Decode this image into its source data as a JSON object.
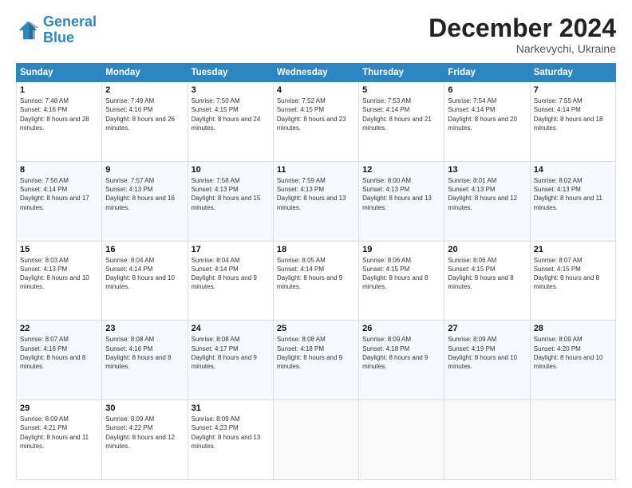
{
  "logo": {
    "line1": "General",
    "line2": "Blue"
  },
  "header": {
    "month": "December 2024",
    "location": "Narkevychi, Ukraine"
  },
  "days_of_week": [
    "Sunday",
    "Monday",
    "Tuesday",
    "Wednesday",
    "Thursday",
    "Friday",
    "Saturday"
  ],
  "weeks": [
    [
      {
        "day": 1,
        "sunrise": "Sunrise: 7:48 AM",
        "sunset": "Sunset: 4:16 PM",
        "daylight": "Daylight: 8 hours and 28 minutes."
      },
      {
        "day": 2,
        "sunrise": "Sunrise: 7:49 AM",
        "sunset": "Sunset: 4:16 PM",
        "daylight": "Daylight: 8 hours and 26 minutes."
      },
      {
        "day": 3,
        "sunrise": "Sunrise: 7:50 AM",
        "sunset": "Sunset: 4:15 PM",
        "daylight": "Daylight: 8 hours and 24 minutes."
      },
      {
        "day": 4,
        "sunrise": "Sunrise: 7:52 AM",
        "sunset": "Sunset: 4:15 PM",
        "daylight": "Daylight: 8 hours and 23 minutes."
      },
      {
        "day": 5,
        "sunrise": "Sunrise: 7:53 AM",
        "sunset": "Sunset: 4:14 PM",
        "daylight": "Daylight: 8 hours and 21 minutes."
      },
      {
        "day": 6,
        "sunrise": "Sunrise: 7:54 AM",
        "sunset": "Sunset: 4:14 PM",
        "daylight": "Daylight: 8 hours and 20 minutes."
      },
      {
        "day": 7,
        "sunrise": "Sunrise: 7:55 AM",
        "sunset": "Sunset: 4:14 PM",
        "daylight": "Daylight: 8 hours and 18 minutes."
      }
    ],
    [
      {
        "day": 8,
        "sunrise": "Sunrise: 7:56 AM",
        "sunset": "Sunset: 4:14 PM",
        "daylight": "Daylight: 8 hours and 17 minutes."
      },
      {
        "day": 9,
        "sunrise": "Sunrise: 7:57 AM",
        "sunset": "Sunset: 4:13 PM",
        "daylight": "Daylight: 8 hours and 16 minutes."
      },
      {
        "day": 10,
        "sunrise": "Sunrise: 7:58 AM",
        "sunset": "Sunset: 4:13 PM",
        "daylight": "Daylight: 8 hours and 15 minutes."
      },
      {
        "day": 11,
        "sunrise": "Sunrise: 7:59 AM",
        "sunset": "Sunset: 4:13 PM",
        "daylight": "Daylight: 8 hours and 13 minutes."
      },
      {
        "day": 12,
        "sunrise": "Sunrise: 8:00 AM",
        "sunset": "Sunset: 4:13 PM",
        "daylight": "Daylight: 8 hours and 13 minutes."
      },
      {
        "day": 13,
        "sunrise": "Sunrise: 8:01 AM",
        "sunset": "Sunset: 4:13 PM",
        "daylight": "Daylight: 8 hours and 12 minutes."
      },
      {
        "day": 14,
        "sunrise": "Sunrise: 8:02 AM",
        "sunset": "Sunset: 4:13 PM",
        "daylight": "Daylight: 8 hours and 11 minutes."
      }
    ],
    [
      {
        "day": 15,
        "sunrise": "Sunrise: 8:03 AM",
        "sunset": "Sunset: 4:13 PM",
        "daylight": "Daylight: 8 hours and 10 minutes."
      },
      {
        "day": 16,
        "sunrise": "Sunrise: 8:04 AM",
        "sunset": "Sunset: 4:14 PM",
        "daylight": "Daylight: 8 hours and 10 minutes."
      },
      {
        "day": 17,
        "sunrise": "Sunrise: 8:04 AM",
        "sunset": "Sunset: 4:14 PM",
        "daylight": "Daylight: 8 hours and 9 minutes."
      },
      {
        "day": 18,
        "sunrise": "Sunrise: 8:05 AM",
        "sunset": "Sunset: 4:14 PM",
        "daylight": "Daylight: 8 hours and 9 minutes."
      },
      {
        "day": 19,
        "sunrise": "Sunrise: 8:06 AM",
        "sunset": "Sunset: 4:15 PM",
        "daylight": "Daylight: 8 hours and 8 minutes."
      },
      {
        "day": 20,
        "sunrise": "Sunrise: 8:06 AM",
        "sunset": "Sunset: 4:15 PM",
        "daylight": "Daylight: 8 hours and 8 minutes."
      },
      {
        "day": 21,
        "sunrise": "Sunrise: 8:07 AM",
        "sunset": "Sunset: 4:15 PM",
        "daylight": "Daylight: 8 hours and 8 minutes."
      }
    ],
    [
      {
        "day": 22,
        "sunrise": "Sunrise: 8:07 AM",
        "sunset": "Sunset: 4:16 PM",
        "daylight": "Daylight: 8 hours and 8 minutes."
      },
      {
        "day": 23,
        "sunrise": "Sunrise: 8:08 AM",
        "sunset": "Sunset: 4:16 PM",
        "daylight": "Daylight: 8 hours and 8 minutes."
      },
      {
        "day": 24,
        "sunrise": "Sunrise: 8:08 AM",
        "sunset": "Sunset: 4:17 PM",
        "daylight": "Daylight: 8 hours and 9 minutes."
      },
      {
        "day": 25,
        "sunrise": "Sunrise: 8:08 AM",
        "sunset": "Sunset: 4:18 PM",
        "daylight": "Daylight: 8 hours and 9 minutes."
      },
      {
        "day": 26,
        "sunrise": "Sunrise: 8:09 AM",
        "sunset": "Sunset: 4:18 PM",
        "daylight": "Daylight: 8 hours and 9 minutes."
      },
      {
        "day": 27,
        "sunrise": "Sunrise: 8:09 AM",
        "sunset": "Sunset: 4:19 PM",
        "daylight": "Daylight: 8 hours and 10 minutes."
      },
      {
        "day": 28,
        "sunrise": "Sunrise: 8:09 AM",
        "sunset": "Sunset: 4:20 PM",
        "daylight": "Daylight: 8 hours and 10 minutes."
      }
    ],
    [
      {
        "day": 29,
        "sunrise": "Sunrise: 8:09 AM",
        "sunset": "Sunset: 4:21 PM",
        "daylight": "Daylight: 8 hours and 11 minutes."
      },
      {
        "day": 30,
        "sunrise": "Sunrise: 8:09 AM",
        "sunset": "Sunset: 4:22 PM",
        "daylight": "Daylight: 8 hours and 12 minutes."
      },
      {
        "day": 31,
        "sunrise": "Sunrise: 8:09 AM",
        "sunset": "Sunset: 4:23 PM",
        "daylight": "Daylight: 8 hours and 13 minutes."
      },
      null,
      null,
      null,
      null
    ]
  ]
}
